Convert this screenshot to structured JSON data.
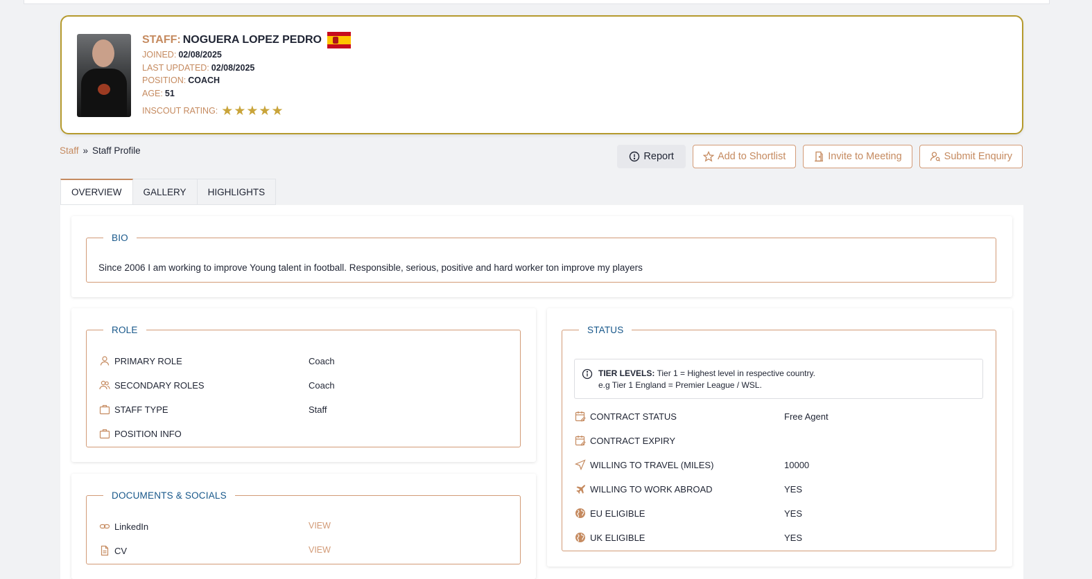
{
  "profile": {
    "staff_label": "STAFF:",
    "name": "NOGUERA LOPEZ PEDRO",
    "flag_icon": "spain-flag",
    "joined_label": "JOINED:",
    "joined": "02/08/2025",
    "updated_label": "LAST UPDATED:",
    "updated": "02/08/2025",
    "position_label": "POSITION:",
    "position": "COACH",
    "age_label": "AGE:",
    "age": "51",
    "rating_label": "INSCOUT RATING:",
    "rating": 5,
    "rating_max": 5
  },
  "breadcrumb": {
    "root": "Staff",
    "sep": "»",
    "current": "Staff Profile"
  },
  "actions": {
    "report": "Report",
    "shortlist": "Add to Shortlist",
    "meeting": "Invite to Meeting",
    "enquiry": "Submit Enquiry"
  },
  "tabs": [
    "OVERVIEW",
    "GALLERY",
    "HIGHLIGHTS"
  ],
  "bio": {
    "legend": "BIO",
    "text": "Since 2006 I am working to improve Young talent in football. Responsible, serious, positive and hard worker ton improve my players"
  },
  "role": {
    "legend": "ROLE",
    "rows": [
      {
        "icon": "user-icon",
        "key": "PRIMARY ROLE",
        "value": "Coach"
      },
      {
        "icon": "users-icon",
        "key": "SECONDARY ROLES",
        "value": "Coach"
      },
      {
        "icon": "briefcase-icon",
        "key": "STAFF TYPE",
        "value": "Staff"
      },
      {
        "icon": "briefcase-icon",
        "key": "POSITION INFO",
        "value": ""
      }
    ]
  },
  "docs": {
    "legend": "DOCUMENTS & SOCIALS",
    "rows": [
      {
        "icon": "link-icon",
        "key": "LinkedIn",
        "value": "VIEW"
      },
      {
        "icon": "file-icon",
        "key": "CV",
        "value": "VIEW"
      }
    ]
  },
  "status": {
    "legend": "STATUS",
    "tier_title": "TIER LEVELS:",
    "tier_line1": "Tier 1 = Highest level in respective country.",
    "tier_line2": "e.g Tier 1 England = Premier League / WSL.",
    "rows": [
      {
        "icon": "calendar-edit-icon",
        "key": "CONTRACT STATUS",
        "value": "Free Agent"
      },
      {
        "icon": "calendar-edit-icon",
        "key": "CONTRACT EXPIRY",
        "value": ""
      },
      {
        "icon": "navigation-icon",
        "key": "WILLING TO TRAVEL (MILES)",
        "value": "10000"
      },
      {
        "icon": "plane-icon",
        "key": "WILLING TO WORK ABROAD",
        "value": "YES"
      },
      {
        "icon": "globe-icon",
        "key": "EU ELIGIBLE",
        "value": "YES"
      },
      {
        "icon": "globe-icon",
        "key": "UK ELIGIBLE",
        "value": "YES"
      }
    ]
  },
  "colors": {
    "accent": "#c58a5f",
    "gold": "#b59a2d",
    "legend_blue": "#17578a"
  }
}
